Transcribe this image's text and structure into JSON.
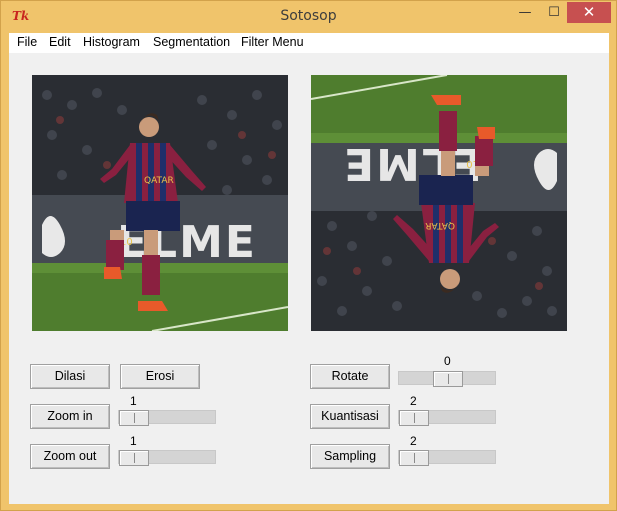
{
  "window": {
    "title": "Sotosop",
    "app_icon": "tk-feather-icon",
    "controls": {
      "minimize": "—",
      "maximize": "☐",
      "close": "✕"
    }
  },
  "menubar": [
    "File",
    "Edit",
    "Histogram",
    "Segmentation",
    "Filter Menu"
  ],
  "buttons": {
    "dilasi": "Dilasi",
    "erosi": "Erosi",
    "zoom_in": "Zoom in",
    "zoom_out": "Zoom out",
    "rotate": "Rotate",
    "kuantisasi": "Kuantisasi",
    "sampling": "Sampling"
  },
  "sliders": {
    "rotate": 0,
    "zoom_in": 1,
    "zoom_out": 1,
    "kuantisasi": 2,
    "sampling": 2
  },
  "images": {
    "left": "original-photo",
    "right": "rotated-photo"
  }
}
